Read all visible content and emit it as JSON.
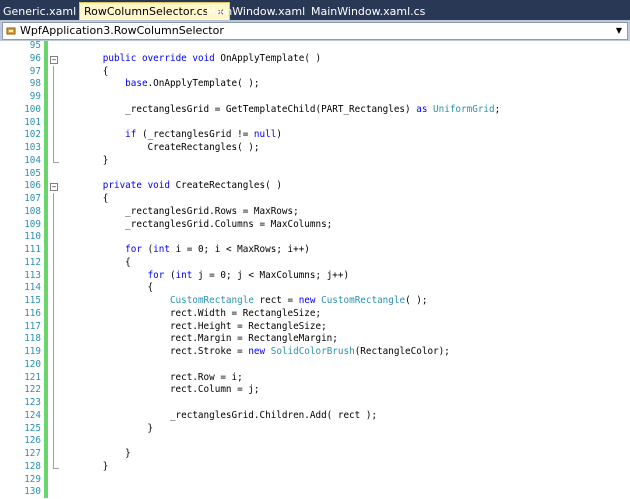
{
  "tabs": [
    {
      "label": "Generic.xaml",
      "active": false
    },
    {
      "label": "RowColumnSelector.cs",
      "active": true
    },
    {
      "label": "MainWindow.xaml",
      "active": false
    },
    {
      "label": "MainWindow.xaml.cs",
      "active": false
    }
  ],
  "tab_close_glyph": "×",
  "nav": {
    "type_selector": "WpfApplication3.RowColumnSelector",
    "dropdown_glyph": "▼"
  },
  "colors": {
    "tab_bar": "#293955",
    "active_tab": "#fff7c9",
    "nav_bar": "#bcc7d8",
    "keyword": "#0000ff",
    "type": "#2b91af",
    "line_number": "#2b91af",
    "change_bar": "#6ad56a"
  },
  "editor": {
    "lines": [
      {
        "n": "95",
        "fold": "",
        "tokens": []
      },
      {
        "n": "96",
        "fold": "start",
        "tokens": [
          [
            "        ",
            ""
          ],
          [
            "public",
            "kw"
          ],
          [
            " ",
            ""
          ],
          [
            "override",
            "kw"
          ],
          [
            " ",
            ""
          ],
          [
            "void",
            "kw"
          ],
          [
            " OnApplyTemplate( )",
            ""
          ]
        ]
      },
      {
        "n": "97",
        "fold": "line",
        "tokens": [
          [
            "        {",
            ""
          ]
        ]
      },
      {
        "n": "98",
        "fold": "line",
        "tokens": [
          [
            "            ",
            ""
          ],
          [
            "base",
            "kw"
          ],
          [
            ".OnApplyTemplate( );",
            ""
          ]
        ]
      },
      {
        "n": "99",
        "fold": "line",
        "tokens": []
      },
      {
        "n": "100",
        "fold": "line",
        "tokens": [
          [
            "            _rectanglesGrid = GetTemplateChild(PART_Rectangles) ",
            ""
          ],
          [
            "as",
            "kw"
          ],
          [
            " ",
            ""
          ],
          [
            "UniformGrid",
            "ty"
          ],
          [
            ";",
            ""
          ]
        ]
      },
      {
        "n": "101",
        "fold": "line",
        "tokens": []
      },
      {
        "n": "102",
        "fold": "line",
        "tokens": [
          [
            "            ",
            ""
          ],
          [
            "if",
            "kw"
          ],
          [
            " (_rectanglesGrid != ",
            ""
          ],
          [
            "null",
            "kw"
          ],
          [
            ")",
            ""
          ]
        ]
      },
      {
        "n": "103",
        "fold": "line",
        "tokens": [
          [
            "                CreateRectangles( );",
            ""
          ]
        ]
      },
      {
        "n": "104",
        "fold": "end",
        "tokens": [
          [
            "        }",
            ""
          ]
        ]
      },
      {
        "n": "105",
        "fold": "",
        "tokens": []
      },
      {
        "n": "106",
        "fold": "start",
        "tokens": [
          [
            "        ",
            ""
          ],
          [
            "private",
            "kw"
          ],
          [
            " ",
            ""
          ],
          [
            "void",
            "kw"
          ],
          [
            " CreateRectangles( )",
            ""
          ]
        ]
      },
      {
        "n": "107",
        "fold": "line",
        "tokens": [
          [
            "        {",
            ""
          ]
        ]
      },
      {
        "n": "108",
        "fold": "line",
        "tokens": [
          [
            "            _rectanglesGrid.Rows = MaxRows;",
            ""
          ]
        ]
      },
      {
        "n": "109",
        "fold": "line",
        "tokens": [
          [
            "            _rectanglesGrid.Columns = MaxColumns;",
            ""
          ]
        ]
      },
      {
        "n": "110",
        "fold": "line",
        "tokens": []
      },
      {
        "n": "111",
        "fold": "line",
        "tokens": [
          [
            "            ",
            ""
          ],
          [
            "for",
            "kw"
          ],
          [
            " (",
            ""
          ],
          [
            "int",
            "kw"
          ],
          [
            " i = 0; i < MaxRows; i++)",
            ""
          ]
        ]
      },
      {
        "n": "112",
        "fold": "line",
        "tokens": [
          [
            "            {",
            ""
          ]
        ]
      },
      {
        "n": "113",
        "fold": "line",
        "tokens": [
          [
            "                ",
            ""
          ],
          [
            "for",
            "kw"
          ],
          [
            " (",
            ""
          ],
          [
            "int",
            "kw"
          ],
          [
            " j = 0; j < MaxColumns; j++)",
            ""
          ]
        ]
      },
      {
        "n": "114",
        "fold": "line",
        "tokens": [
          [
            "                {",
            ""
          ]
        ]
      },
      {
        "n": "115",
        "fold": "line",
        "tokens": [
          [
            "                    ",
            ""
          ],
          [
            "CustomRectangle",
            "ty"
          ],
          [
            " rect = ",
            ""
          ],
          [
            "new",
            "kw"
          ],
          [
            " ",
            ""
          ],
          [
            "CustomRectangle",
            "ty"
          ],
          [
            "( );",
            ""
          ]
        ]
      },
      {
        "n": "116",
        "fold": "line",
        "tokens": [
          [
            "                    rect.Width = RectangleSize;",
            ""
          ]
        ]
      },
      {
        "n": "117",
        "fold": "line",
        "tokens": [
          [
            "                    rect.Height = RectangleSize;",
            ""
          ]
        ]
      },
      {
        "n": "118",
        "fold": "line",
        "tokens": [
          [
            "                    rect.Margin = RectangleMargin;",
            ""
          ]
        ]
      },
      {
        "n": "119",
        "fold": "line",
        "tokens": [
          [
            "                    rect.Stroke = ",
            ""
          ],
          [
            "new",
            "kw"
          ],
          [
            " ",
            ""
          ],
          [
            "SolidColorBrush",
            "ty"
          ],
          [
            "(RectangleColor);",
            ""
          ]
        ]
      },
      {
        "n": "120",
        "fold": "line",
        "tokens": []
      },
      {
        "n": "121",
        "fold": "line",
        "tokens": [
          [
            "                    rect.Row = i;",
            ""
          ]
        ]
      },
      {
        "n": "122",
        "fold": "line",
        "tokens": [
          [
            "                    rect.Column = j;",
            ""
          ]
        ]
      },
      {
        "n": "123",
        "fold": "line",
        "tokens": []
      },
      {
        "n": "124",
        "fold": "line",
        "tokens": [
          [
            "                    _rectanglesGrid.Children.Add( rect );",
            ""
          ]
        ]
      },
      {
        "n": "125",
        "fold": "line",
        "tokens": [
          [
            "                }",
            ""
          ]
        ]
      },
      {
        "n": "126",
        "fold": "line",
        "tokens": []
      },
      {
        "n": "127",
        "fold": "line",
        "tokens": [
          [
            "            }",
            ""
          ]
        ]
      },
      {
        "n": "128",
        "fold": "end",
        "tokens": [
          [
            "        }",
            ""
          ]
        ]
      },
      {
        "n": "129",
        "fold": "",
        "tokens": []
      },
      {
        "n": "130",
        "fold": "",
        "tokens": []
      }
    ]
  }
}
